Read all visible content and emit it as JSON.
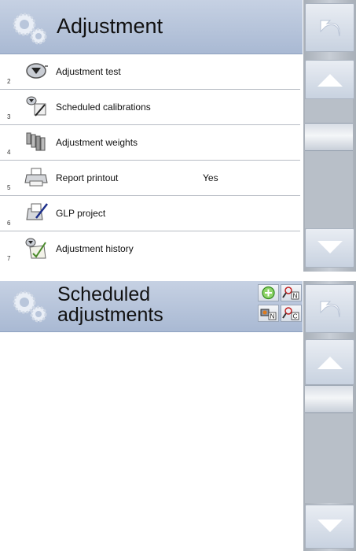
{
  "panel1": {
    "title": "Adjustment",
    "items": [
      {
        "num": "2",
        "label": "Adjustment test",
        "value": "",
        "icon": "adjustment-test-icon"
      },
      {
        "num": "3",
        "label": "Scheduled calibrations",
        "value": "",
        "icon": "scheduled-calibration-icon"
      },
      {
        "num": "4",
        "label": "Adjustment weights",
        "value": "",
        "icon": "weights-icon"
      },
      {
        "num": "5",
        "label": "Report printout",
        "value": "Yes",
        "icon": "printer-icon"
      },
      {
        "num": "6",
        "label": "GLP project",
        "value": "",
        "icon": "glp-project-icon"
      },
      {
        "num": "7",
        "label": "Adjustment history",
        "value": "",
        "icon": "history-icon"
      }
    ]
  },
  "panel2": {
    "title_line1": "Scheduled",
    "title_line2": "adjustments",
    "tools": [
      "add-icon",
      "search-by-name-icon",
      "edit-record-icon",
      "search-by-code-icon"
    ],
    "tool_letters": {
      "name": "N",
      "code": "C",
      "record": "N"
    }
  },
  "colors": {
    "titlebar": "#b5c3da",
    "sidebar": "#b8bfc8",
    "button": "#dfe5ee"
  }
}
